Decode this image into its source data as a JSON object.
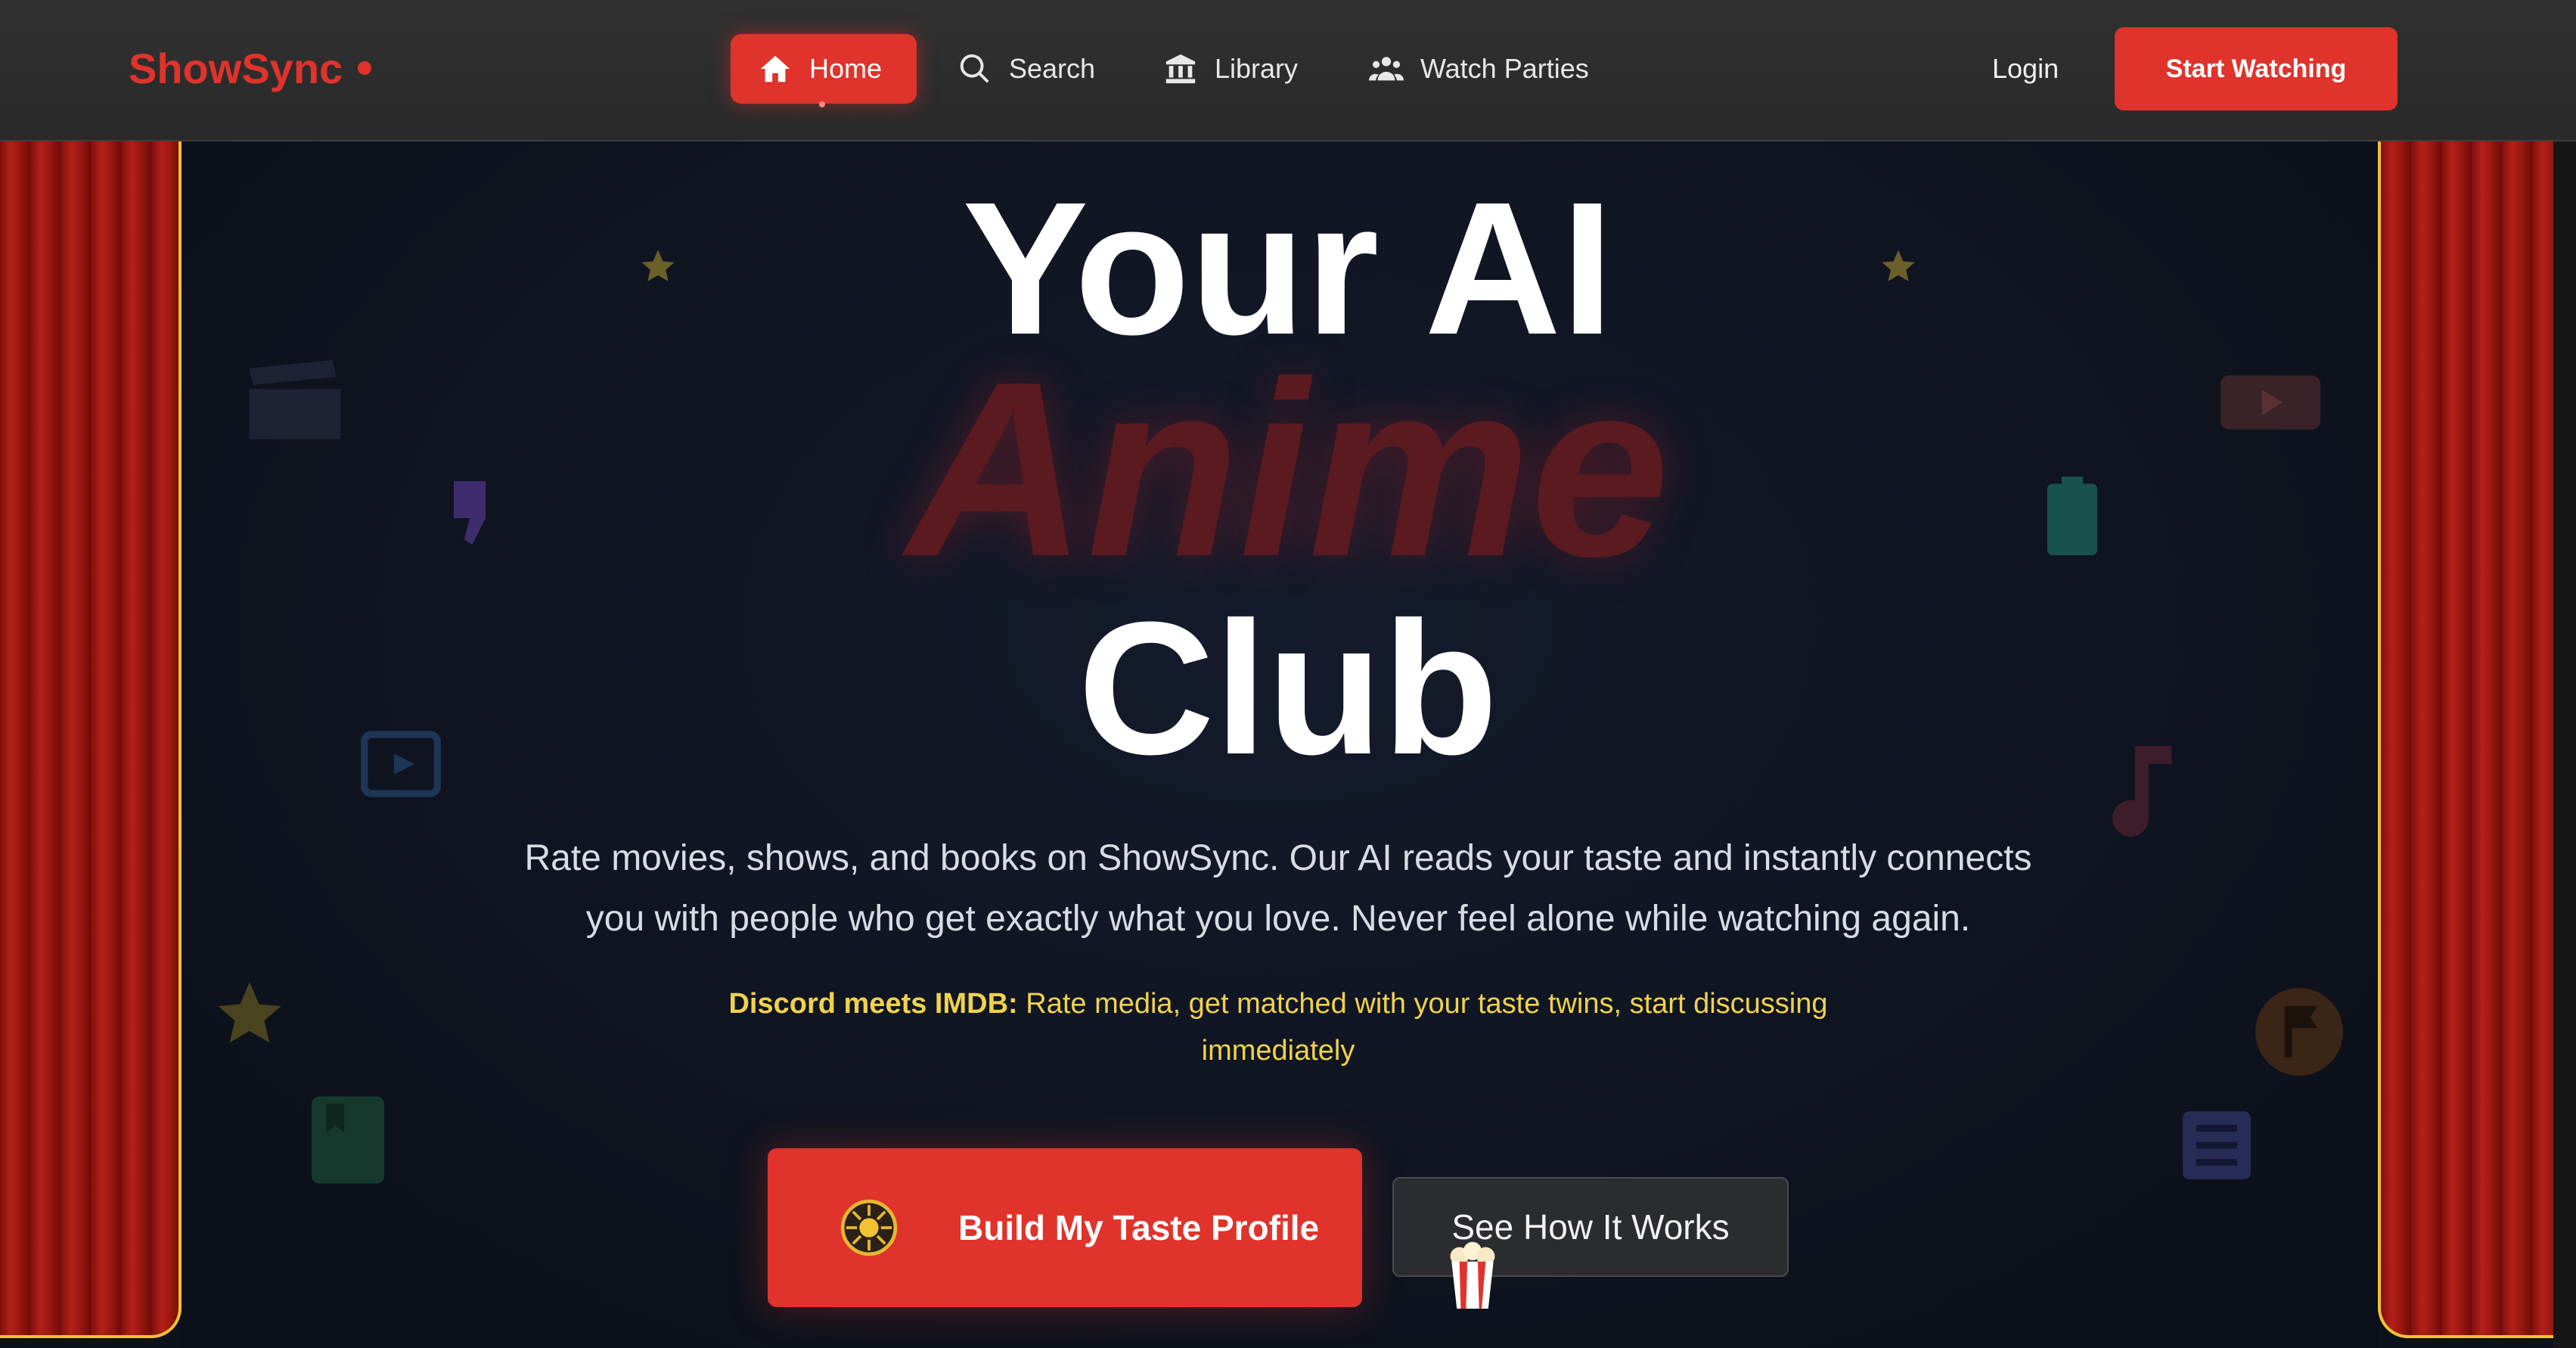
{
  "brand": {
    "name": "ShowSync"
  },
  "nav": {
    "items": [
      {
        "label": "Home",
        "icon": "home-icon",
        "active": true
      },
      {
        "label": "Search",
        "icon": "search-icon"
      },
      {
        "label": "Library",
        "icon": "library-icon"
      },
      {
        "label": "Watch Parties",
        "icon": "users-icon"
      }
    ],
    "login": "Login",
    "cta": "Start Watching"
  },
  "hero": {
    "line1": "Your AI",
    "line2": "Anime",
    "line3": "Club",
    "subtitle_1": "Rate movies, shows, and books on ShowSync. Our AI reads your taste and instantly connects",
    "subtitle_2": "you with people who get exactly what you love. Never feel alone while watching again.",
    "tagline_bold": "Discord meets IMDB:",
    "tagline_rest": " Rate media, get matched with your taste twins, start discussing immediately"
  },
  "buttons": {
    "primary": "Build My Taste Profile",
    "secondary": "See How It Works"
  },
  "colors": {
    "accent": "#e0332b",
    "gold": "#f1c232",
    "tagline": "#f1d24a",
    "background": "#0d111c",
    "nav_bg": "#2d2d2d"
  },
  "decorations": [
    "star-icon",
    "clapperboard-icon",
    "thumbs-down-icon",
    "video-icon",
    "book-icon",
    "youtube-icon",
    "battery-icon",
    "music-note-icon",
    "flag-icon",
    "document-icon",
    "popcorn-icon",
    "film-reel-icon"
  ]
}
